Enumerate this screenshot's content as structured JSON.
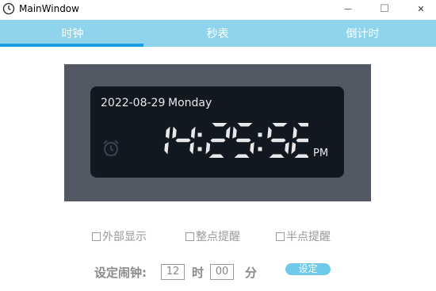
{
  "window": {
    "title": "MainWindow",
    "minimize_glyph": "—",
    "maximize_glyph": "☐",
    "close_glyph": "✕"
  },
  "tabs": [
    {
      "label": "时钟",
      "active": true
    },
    {
      "label": "秒表",
      "active": false
    },
    {
      "label": "倒计时",
      "active": false
    }
  ],
  "clock": {
    "date": "2022-08-29",
    "weekday": "Monday",
    "time": "14:25:58",
    "ampm": "PM",
    "alarm_icon": "alarm-clock-icon"
  },
  "options": [
    {
      "label": "外部显示",
      "checked": false
    },
    {
      "label": "整点提醒",
      "checked": false
    },
    {
      "label": "半点提醒",
      "checked": false
    }
  ],
  "alarm": {
    "label": "设定闹钟:",
    "hour": "12",
    "hour_unit": "时",
    "minute": "00",
    "minute_unit": "分",
    "set_button": "设定"
  },
  "colors": {
    "tab_bar": "#8fd3ec",
    "tab_indicator": "#1a9be6",
    "panel": "#525964",
    "lcd_background": "#111820",
    "digits": "#e8e8e8",
    "set_button": "#6fc9e9"
  }
}
